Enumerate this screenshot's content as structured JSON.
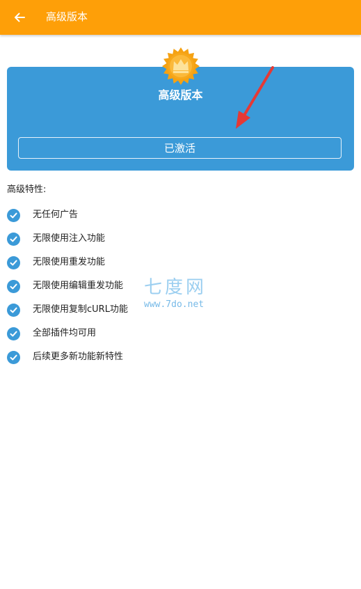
{
  "topbar": {
    "back_icon": "arrow-left-icon",
    "title": "高级版本",
    "background": "#fe9f08"
  },
  "card": {
    "badge_icon": "crown-badge-icon",
    "title": "高级版本",
    "button_label": "已激活",
    "background": "#3b9ad8"
  },
  "features": {
    "heading": "高级特性:",
    "items": [
      {
        "label": "无任何广告"
      },
      {
        "label": "无限使用注入功能"
      },
      {
        "label": "无限使用重发功能"
      },
      {
        "label": "无限使用编辑重发功能"
      },
      {
        "label": "无限使用复制cURL功能"
      },
      {
        "label": "全部插件均可用"
      },
      {
        "label": "后续更多新功能新特性"
      }
    ],
    "check_icon": "check-circle-icon",
    "check_color": "#3b9ad8"
  },
  "watermark": {
    "text": "七度网",
    "url": "www.7do.net"
  },
  "annotation": {
    "arrow_icon": "red-arrow-icon",
    "color": "#e53935"
  }
}
